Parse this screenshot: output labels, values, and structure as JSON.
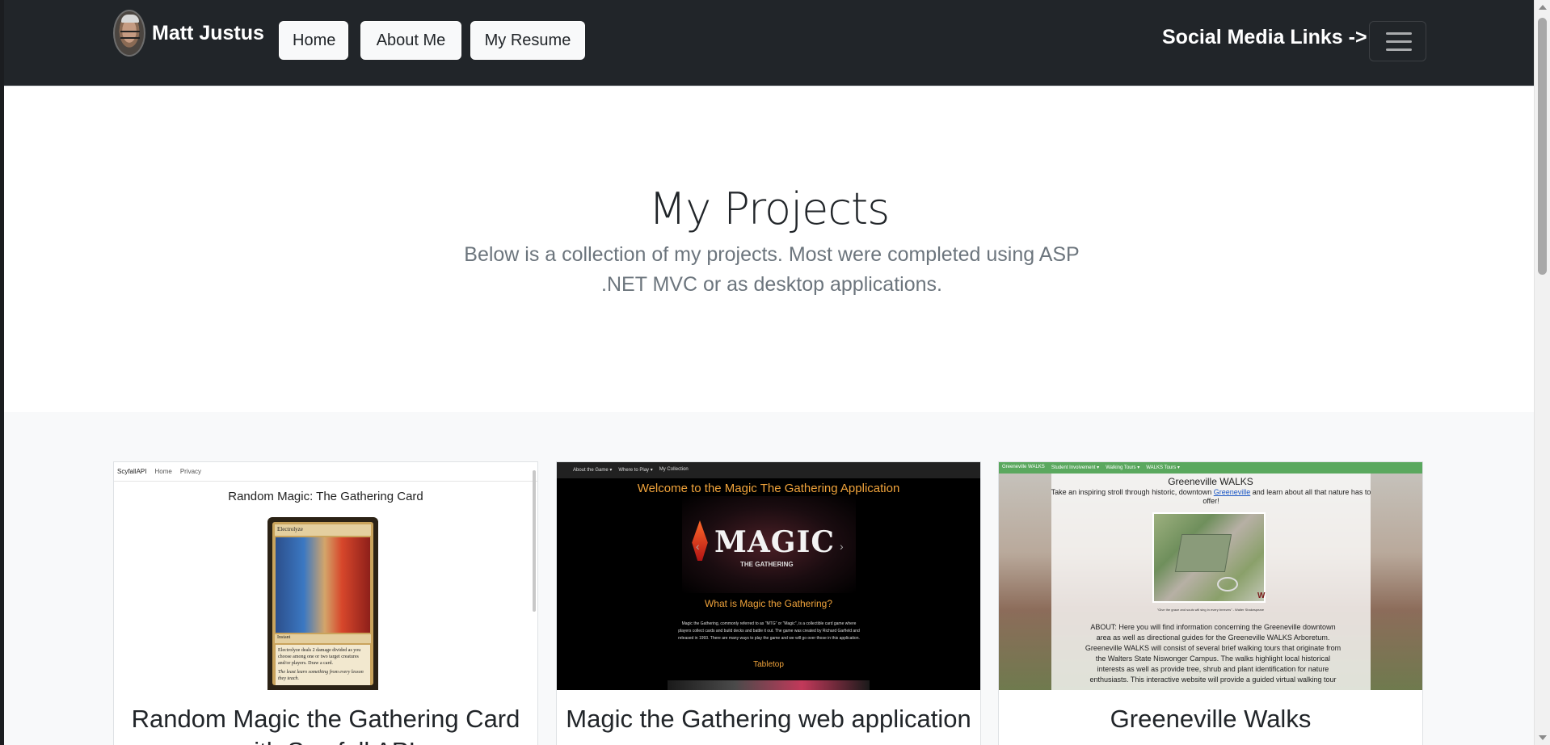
{
  "navbar": {
    "brand_name": "Matt Justus",
    "buttons": [
      {
        "label": "Home"
      },
      {
        "label": "About Me"
      },
      {
        "label": "My Resume"
      }
    ],
    "social_label": "Social Media Links ->",
    "toggler_icon": "hamburger-menu-icon"
  },
  "hero": {
    "title": "My Projects",
    "subtitle": "Below is a collection of my projects. Most were completed using ASP .NET MVC or as desktop applications."
  },
  "projects": [
    {
      "title": "Random Magic the Gathering Card with Scryfall API",
      "thumb": {
        "nav_brand": "ScyfallAPI",
        "nav_links": [
          "Home",
          "Privacy"
        ],
        "heading": "Random Magic: The Gathering Card",
        "card_name": "Electrolyze",
        "card_type": "Instant",
        "card_text": "Electrolyze deals 2 damage divided as you choose among one or two target creatures and/or players. Draw a card.",
        "card_flavor": "The least learn something from every lesson they teach."
      }
    },
    {
      "title": "Magic the Gathering web application",
      "thumb": {
        "nav_links": [
          "About the Game ▾",
          "Where to Play ▾",
          "My Collection"
        ],
        "welcome": "Welcome to the Magic The Gathering Application",
        "logo": "MAGIC",
        "logo_sub": "THE GATHERING",
        "question": "What is Magic the Gathering?",
        "description": "Magic the Gathering, commonly referred to as \"MTG\" or \"Magic\", is a collectible card game where players collect cards and build decks and battle it out. The game was created by Richard Garfield and released in 1993. There are many ways to play the game and we will go over those in this application.",
        "section": "Tabletop"
      }
    },
    {
      "title": "Greeneville Walks",
      "thumb": {
        "nav_links": [
          "Greeneville WALKS",
          "Student Involvement ▾",
          "Walking Tours ▾",
          "WALKS Tours ▾"
        ],
        "heading": "Greeneville WALKS",
        "intro_before": "Take an inspiring stroll through historic, downtown ",
        "intro_link": "Greeneville",
        "intro_after": " and learn about all that nature has to offer!",
        "logo_mark": "W",
        "quote": "\"Give the grace and souls will sing in every breezes\" - Walter Shakespeare",
        "about": "ABOUT: Here you will find information concerning the Greeneville downtown area as well as directional guides for the Greeneville WALKS Arboretum. Greeneville WALKS will consist of several brief walking tours that originate from the Walters State Niswonger Campus. The walks highlight local historical interests as well as provide tree, shrub and plant identification for nature enthusiasts. This interactive website will provide a guided virtual walking tour"
      }
    }
  ]
}
